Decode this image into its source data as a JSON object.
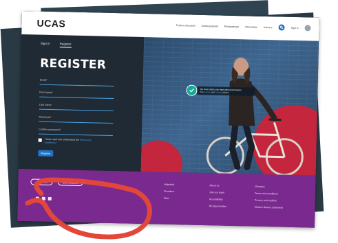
{
  "header": {
    "logo": "UCAS",
    "nav": [
      "Further education",
      "Undergraduate",
      "Postgraduate",
      "Internships",
      "Careers"
    ],
    "sign_in": "Sign in"
  },
  "form": {
    "tabs": [
      "Sign in",
      "Register"
    ],
    "active_tab": "Register",
    "title": "REGISTER",
    "fields": [
      "Email*",
      "First name*",
      "Last name",
      "Password*",
      "Confirm password*"
    ],
    "terms_text": "I have read and understand the",
    "terms_link": "Terms and",
    "terms_link2": "conditions*",
    "submit": "Register"
  },
  "notice": {
    "line1": "We never share your data without permission.",
    "line2_prefix": "See",
    "line2_link1": "privacy",
    "line2_mid": "and",
    "line2_link2": "cookie",
    "line2_suffix": "policies"
  },
  "footer": {
    "contact_button": "Contact us",
    "feedback_button": "Give feedback",
    "col1": [
      "Helpdesk",
      "Providers",
      "Data"
    ],
    "col2": [
      "About us",
      "Join our team",
      "Accessibility",
      "All opportunities"
    ],
    "col3": [
      "Glossary",
      "Terms and conditions",
      "Privacy and cookies",
      "Modern slavery statement"
    ]
  },
  "colors": {
    "brand_dark": "#1f2a35",
    "accent_blue": "#1e74c6",
    "footer_purple": "#7a2a8f",
    "accent_red": "#c3263d",
    "badge_teal": "#15a99a"
  }
}
